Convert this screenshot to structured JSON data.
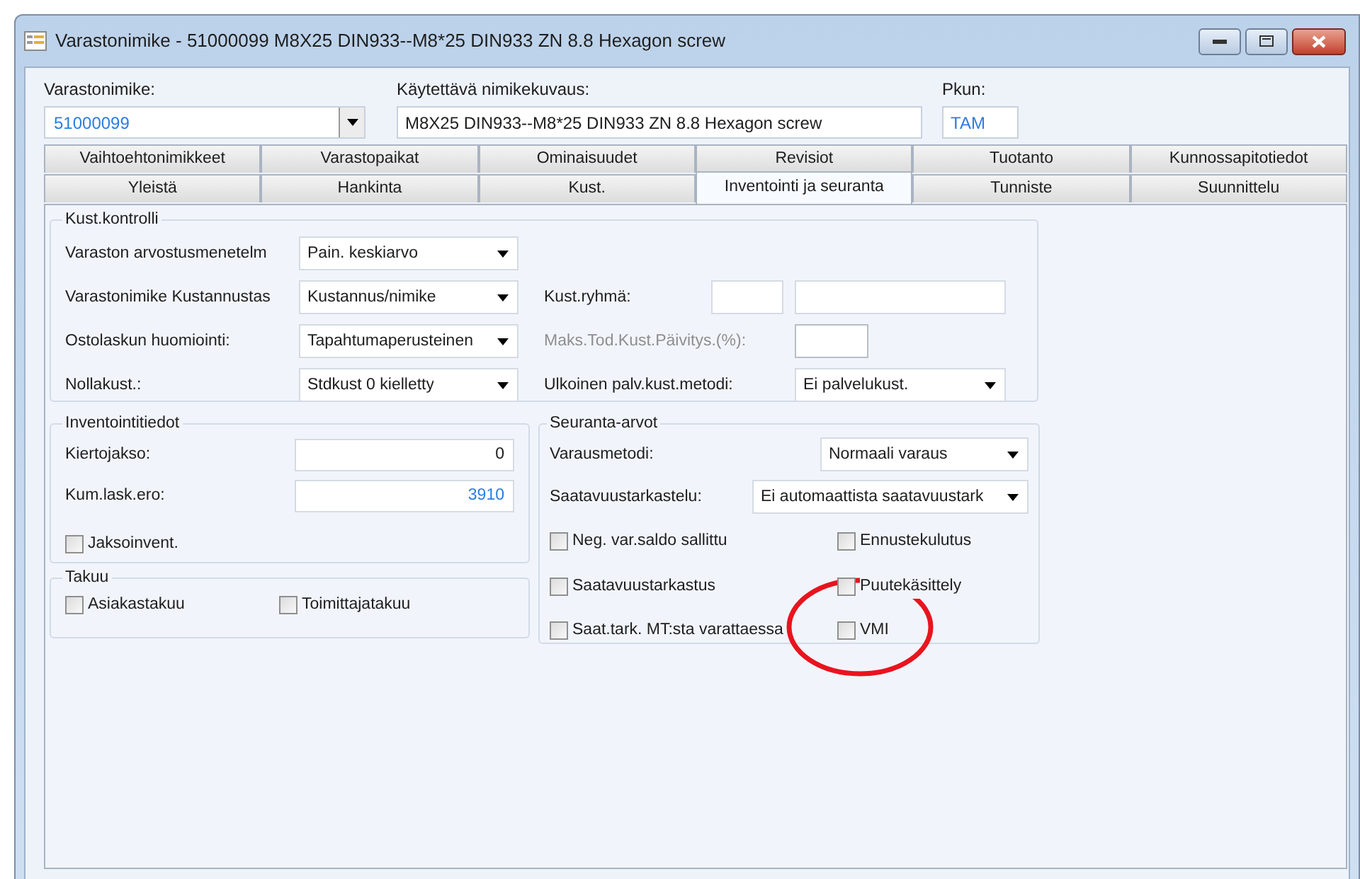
{
  "window": {
    "title": "Varastonimike - 51000099 M8X25 DIN933--M8*25 DIN933 ZN 8.8 Hexagon screw"
  },
  "header": {
    "item_code": {
      "label": "Varastonimike:",
      "value": "51000099"
    },
    "description": {
      "label": "Käytettävä nimikekuvaus:",
      "value": "M8X25 DIN933--M8*25 DIN933 ZN 8.8 Hexagon screw"
    },
    "pkun": {
      "label": "Pkun:",
      "value": "TAM"
    }
  },
  "tab_rows": [
    [
      {
        "label": "Vaihtoehtonimikkeet",
        "selected": false
      },
      {
        "label": "Varastopaikat",
        "selected": false
      },
      {
        "label": "Ominaisuudet",
        "selected": false
      },
      {
        "label": "Revisiot",
        "selected": false
      },
      {
        "label": "Tuotanto",
        "selected": false
      },
      {
        "label": "Kunnossapitotiedot",
        "selected": false
      }
    ],
    [
      {
        "label": "Yleistä",
        "selected": false
      },
      {
        "label": "Hankinta",
        "selected": false
      },
      {
        "label": "Kust.",
        "selected": false
      },
      {
        "label": "Inventointi ja seuranta",
        "selected": true
      },
      {
        "label": "Tunniste",
        "selected": false
      },
      {
        "label": "Suunnittelu",
        "selected": false
      }
    ]
  ],
  "kust_kontrolli": {
    "title": "Kust.kontrolli",
    "left_fields": [
      {
        "label": "Varaston arvostusmenetelm",
        "value": "Pain. keskiarvo"
      },
      {
        "label": "Varastonimike Kustannustas",
        "value": "Kustannus/nimike"
      },
      {
        "label": "Ostolaskun huomiointi:",
        "value": "Tapahtumaperusteinen"
      },
      {
        "label": "Nollakust.:",
        "value": "Stdkust 0 kielletty"
      }
    ],
    "right_fields": [
      {
        "kind": "two_inputs",
        "label": "Kust.ryhmä:",
        "disabled": false
      },
      {
        "kind": "input",
        "label": "Maks.Tod.Kust.Päivitys.(%):",
        "disabled": true
      },
      {
        "kind": "select",
        "label": "Ulkoinen palv.kust.metodi:",
        "disabled": false,
        "value": "Ei palvelukust."
      }
    ]
  },
  "inventointitiedot": {
    "title": "Inventointitiedot",
    "fields": [
      {
        "label": "Kiertojakso:",
        "value": "0",
        "linked": false
      },
      {
        "label": "Kum.lask.ero:",
        "value": "3910",
        "linked": true
      }
    ],
    "checkbox": {
      "label": "Jaksoinvent.",
      "checked": false
    }
  },
  "takuu": {
    "title": "Takuu",
    "checkboxes": [
      {
        "label": "Asiakastakuu",
        "checked": false
      },
      {
        "label": "Toimittajatakuu",
        "checked": false
      }
    ]
  },
  "seuranta_arvot": {
    "title": "Seuranta-arvot",
    "selects": [
      {
        "label": "Varausmetodi:",
        "value": "Normaali varaus"
      },
      {
        "label": "Saatavuustarkastelu:",
        "value": "Ei automaattista saatavuustark"
      }
    ],
    "checkboxes": [
      {
        "label": "Neg. var.saldo sallittu",
        "checked": false
      },
      {
        "label": "Ennustekulutus",
        "checked": false
      },
      {
        "label": "Saatavuustarkastus",
        "checked": false
      },
      {
        "label": "Puutekäsittely",
        "checked": false
      },
      {
        "label": "Saat.tark. MT:sta varattaessa",
        "checked": false
      },
      {
        "label": "VMI",
        "checked": false
      }
    ]
  }
}
